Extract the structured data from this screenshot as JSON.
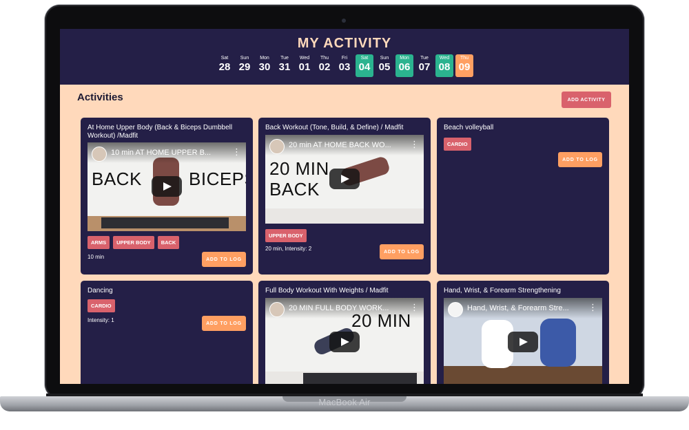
{
  "device": {
    "brand": "MacBook Air"
  },
  "header": {
    "title": "MY ACTIVITY",
    "days": [
      {
        "name": "Sat",
        "date": "28",
        "state": "normal"
      },
      {
        "name": "Sun",
        "date": "29",
        "state": "normal"
      },
      {
        "name": "Mon",
        "date": "30",
        "state": "normal"
      },
      {
        "name": "Tue",
        "date": "31",
        "state": "normal"
      },
      {
        "name": "Wed",
        "date": "01",
        "state": "normal"
      },
      {
        "name": "Thu",
        "date": "02",
        "state": "normal"
      },
      {
        "name": "Fri",
        "date": "03",
        "state": "normal"
      },
      {
        "name": "Sat",
        "date": "04",
        "state": "active"
      },
      {
        "name": "Sun",
        "date": "05",
        "state": "normal"
      },
      {
        "name": "Mon",
        "date": "06",
        "state": "active"
      },
      {
        "name": "Tue",
        "date": "07",
        "state": "normal"
      },
      {
        "name": "Wed",
        "date": "08",
        "state": "active"
      },
      {
        "name": "Thu",
        "date": "09",
        "state": "today"
      }
    ]
  },
  "activities": {
    "title": "Activities",
    "add_label": "ADD ACTIVITY",
    "cards": [
      {
        "title": "At Home Upper Body (Back & Biceps Dumbbell Workout) /Madfit",
        "video_title": "10 min AT HOME UPPER B...",
        "video_text_left": "BACK",
        "video_text_right": "BICEPS",
        "tags": [
          "ARMS",
          "UPPER BODY",
          "BACK"
        ],
        "meta": "10 min",
        "log_label": "ADD TO LOG"
      },
      {
        "title": "Back Workout (Tone, Build, & Define) / Madfit",
        "video_title": "20 min AT HOME BACK WO...",
        "video_text_left": "20 MIN",
        "video_text_right": "BACK",
        "tags": [
          "UPPER BODY"
        ],
        "meta": "20 min, Intensity: 2",
        "log_label": "ADD TO LOG"
      },
      {
        "title": "Beach volleyball",
        "tags": [
          "CARDIO"
        ],
        "meta": "",
        "log_label": "ADD TO LOG"
      },
      {
        "title": "Dancing",
        "tags": [
          "CARDIO"
        ],
        "meta": "Intensity: 1",
        "log_label": "ADD TO LOG"
      },
      {
        "title": "Full Body Workout With Weights / Madfit",
        "video_title": "20 MIN FULL BODY WORK...",
        "video_text_right": "20 MIN"
      },
      {
        "title": "Hand, Wrist, & Forearm Strengthening",
        "video_title": "Hand, Wrist, & Forearm Stre..."
      }
    ]
  },
  "colors": {
    "header_bg": "#241f47",
    "page_bg": "#ffd9bb",
    "active_day": "#2bb38f",
    "today": "#ff9f62",
    "tag": "#d9626c",
    "log_button": "#ff9f62"
  }
}
